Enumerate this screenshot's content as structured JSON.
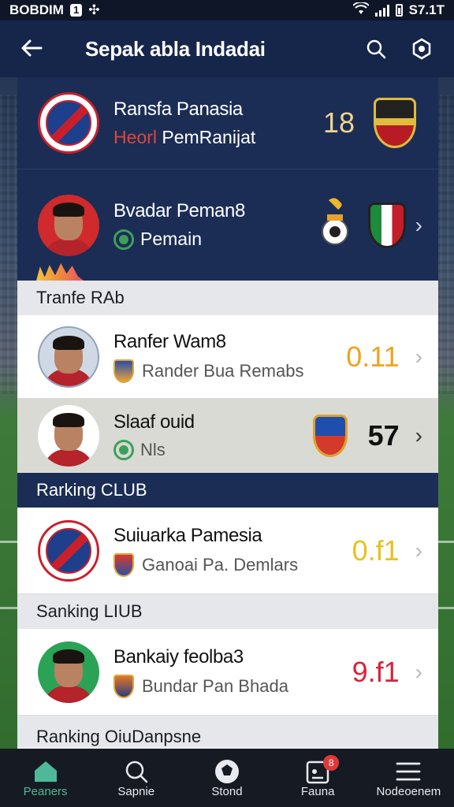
{
  "status_bar": {
    "carrier": "BOBDIM",
    "badge": "1",
    "time": "S7.1T"
  },
  "app_bar": {
    "title": "Sepak abla Indadai"
  },
  "featured": [
    {
      "name": "Ransfa Panasia",
      "sub_accent": "Heorl",
      "sub_rest": "PemRanijat",
      "value": "18"
    },
    {
      "name": "Bvadar Peman8",
      "sub": "Pemain"
    }
  ],
  "sections": {
    "transfer": "Tranfe RAb",
    "ranking": "Rarking CLUB",
    "stanking": "Sanking LIUB",
    "bottom_cut": "Ranking OiuDanpsne"
  },
  "transfer_rows": [
    {
      "name": "Ranfer Wam8",
      "sub": "Rander Bua Remabs",
      "value": "0.11"
    },
    {
      "name": "Slaaf ouid",
      "sub": "Nls",
      "value": "57"
    }
  ],
  "ranking_rows": [
    {
      "name": "Suiuarka Pamesia",
      "sub": "Ganoai Pa. Demlars",
      "value": "0.f1"
    }
  ],
  "stanking_rows": [
    {
      "name": "Bankaiy feolba3",
      "sub": "Bundar Pan Bhada",
      "value": "9.f1"
    }
  ],
  "nav": [
    {
      "label": "Peaners",
      "icon": "home-icon",
      "active": true
    },
    {
      "label": "Sapnie",
      "icon": "search-icon"
    },
    {
      "label": "Stond",
      "icon": "ball-icon"
    },
    {
      "label": "Fauna",
      "icon": "notification-icon",
      "badge": "8"
    },
    {
      "label": "Nodeoenem",
      "icon": "menu-icon"
    }
  ],
  "colors": {
    "navy": "#15264a",
    "accent_green": "#4fb899",
    "orange": "#f0a21d",
    "red": "#d9223a"
  }
}
